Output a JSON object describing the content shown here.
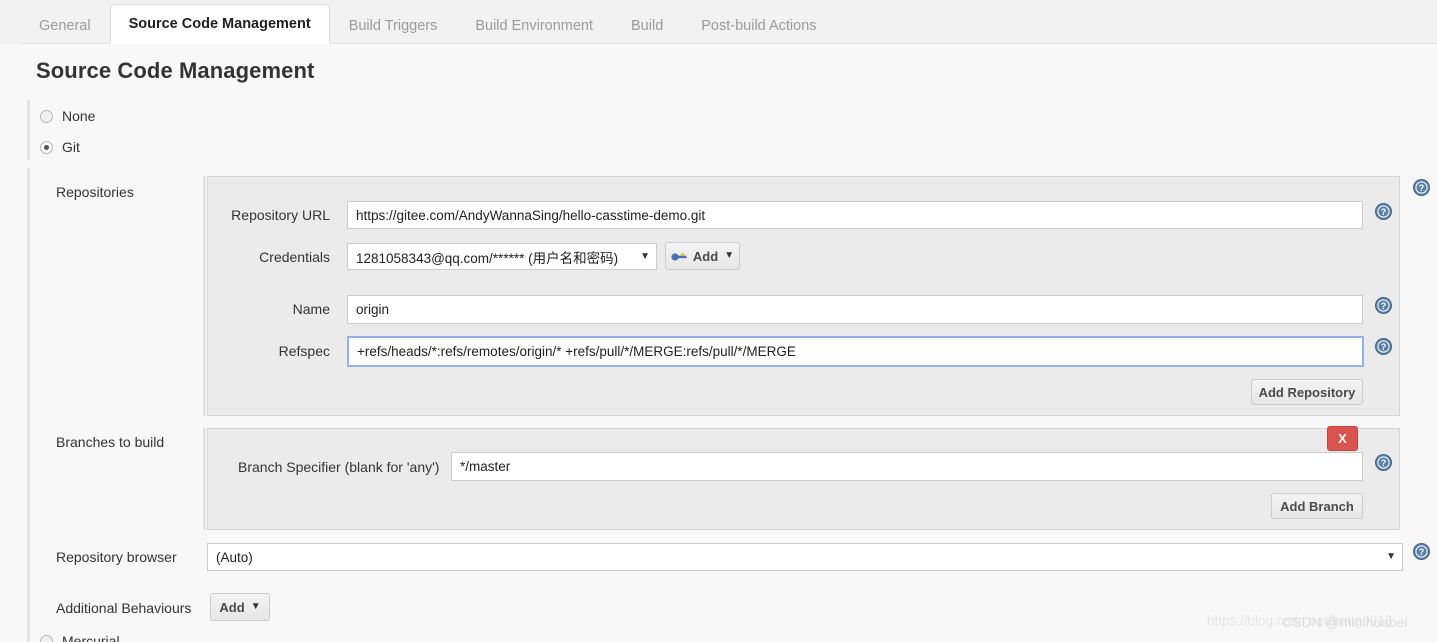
{
  "tabs": [
    {
      "label": "General",
      "active": false
    },
    {
      "label": "Source Code Management",
      "active": true
    },
    {
      "label": "Build Triggers",
      "active": false
    },
    {
      "label": "Build Environment",
      "active": false
    },
    {
      "label": "Build",
      "active": false
    },
    {
      "label": "Post-build Actions",
      "active": false
    }
  ],
  "page": {
    "title": "Source Code Management"
  },
  "scm_options": [
    {
      "label": "None",
      "checked": false
    },
    {
      "label": "Git",
      "checked": true
    },
    {
      "label": "Mercurial",
      "checked": false
    }
  ],
  "repositories": {
    "section_label": "Repositories",
    "fields": {
      "repository_url_label": "Repository URL",
      "repository_url_value": "https://gitee.com/AndyWannaSing/hello-casstime-demo.git",
      "credentials_label": "Credentials",
      "credentials_value": "1281058343@qq.com/****** (用户名和密码)",
      "credentials_add_label": "Add",
      "name_label": "Name",
      "name_value": "origin",
      "refspec_label": "Refspec",
      "refspec_value": "+refs/heads/*:refs/remotes/origin/* +refs/pull/*/MERGE:refs/pull/*/MERGE"
    },
    "add_repository_label": "Add Repository"
  },
  "branches": {
    "section_label": "Branches to build",
    "branch_specifier_label": "Branch Specifier (blank for 'any')",
    "branch_specifier_value": "*/master",
    "delete_label": "X",
    "add_branch_label": "Add Branch"
  },
  "repository_browser": {
    "label": "Repository browser",
    "value": "(Auto)"
  },
  "additional_behaviours": {
    "label": "Additional Behaviours",
    "add_label": "Add"
  },
  "watermarks": {
    "url": "https://blog.csdn.net/lixing0013",
    "csdn": "CSDN @minihuabei"
  },
  "colors": {
    "accent_red": "#d9534f",
    "help_blue": "#4a6f9e",
    "focus_blue": "#93b1e8",
    "panel_gray": "#ebebeb"
  }
}
